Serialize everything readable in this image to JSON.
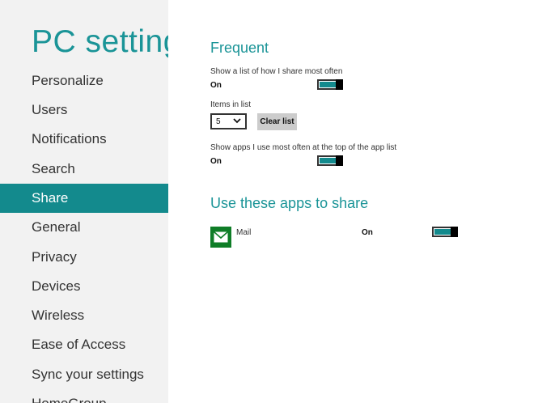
{
  "sidebar": {
    "title": "PC settings",
    "items": [
      {
        "label": "Personalize"
      },
      {
        "label": "Users"
      },
      {
        "label": "Notifications"
      },
      {
        "label": "Search"
      },
      {
        "label": "Share",
        "selected": true
      },
      {
        "label": "General"
      },
      {
        "label": "Privacy"
      },
      {
        "label": "Devices"
      },
      {
        "label": "Wireless"
      },
      {
        "label": "Ease of Access"
      },
      {
        "label": "Sync your settings"
      },
      {
        "label": "HomeGroup"
      }
    ]
  },
  "frequent": {
    "heading": "Frequent",
    "share_list": {
      "label": "Show a list of how I share most often",
      "state": "On"
    },
    "items_in_list": {
      "label": "Items in list",
      "value": "5",
      "clear_label": "Clear list"
    },
    "apps_at_top": {
      "label": "Show apps I use most often at the top of the app list",
      "state": "On"
    }
  },
  "share_apps": {
    "heading": "Use these apps to share",
    "apps": [
      {
        "name": "Mail",
        "state": "On",
        "icon": "mail-icon"
      }
    ]
  },
  "colors": {
    "accent": "#138a8d",
    "heading": "#1a9497",
    "sidebar_bg": "#f2f2f2",
    "mail_tile": "#0f7d27"
  }
}
